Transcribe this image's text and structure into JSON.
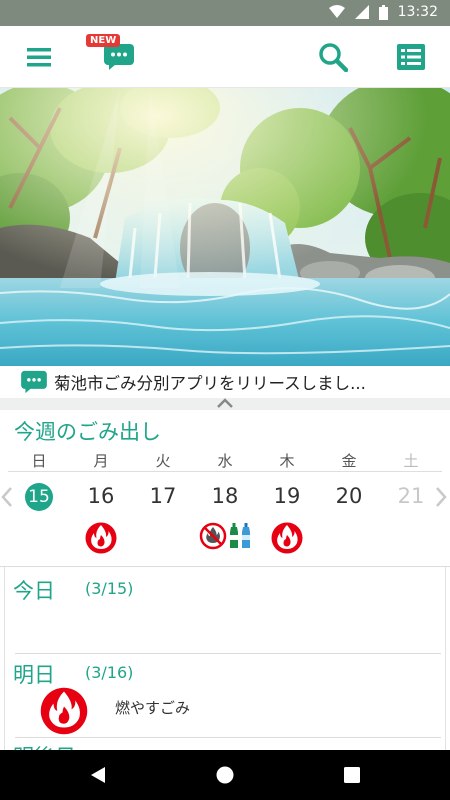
{
  "status": {
    "time": "13:32"
  },
  "appbar": {
    "new_badge": "NEW",
    "icons": [
      "menu-icon",
      "chat-icon",
      "search-icon",
      "list-icon"
    ]
  },
  "notice": {
    "text": "菊池市ごみ分別アプリをリリースしまし..."
  },
  "week": {
    "title": "今週のごみ出し",
    "days": [
      "日",
      "月",
      "火",
      "水",
      "木",
      "金",
      "土"
    ],
    "dates": [
      "15",
      "16",
      "17",
      "18",
      "19",
      "20",
      "21"
    ]
  },
  "today": {
    "label": "今日",
    "date": "(3/15)"
  },
  "tomorrow": {
    "label": "明日",
    "date": "(3/16)",
    "garbage": "燃やすごみ"
  },
  "day_after": {
    "label": "明後日"
  },
  "colors": {
    "accent": "#21a58a",
    "burnable": "#e60012"
  }
}
